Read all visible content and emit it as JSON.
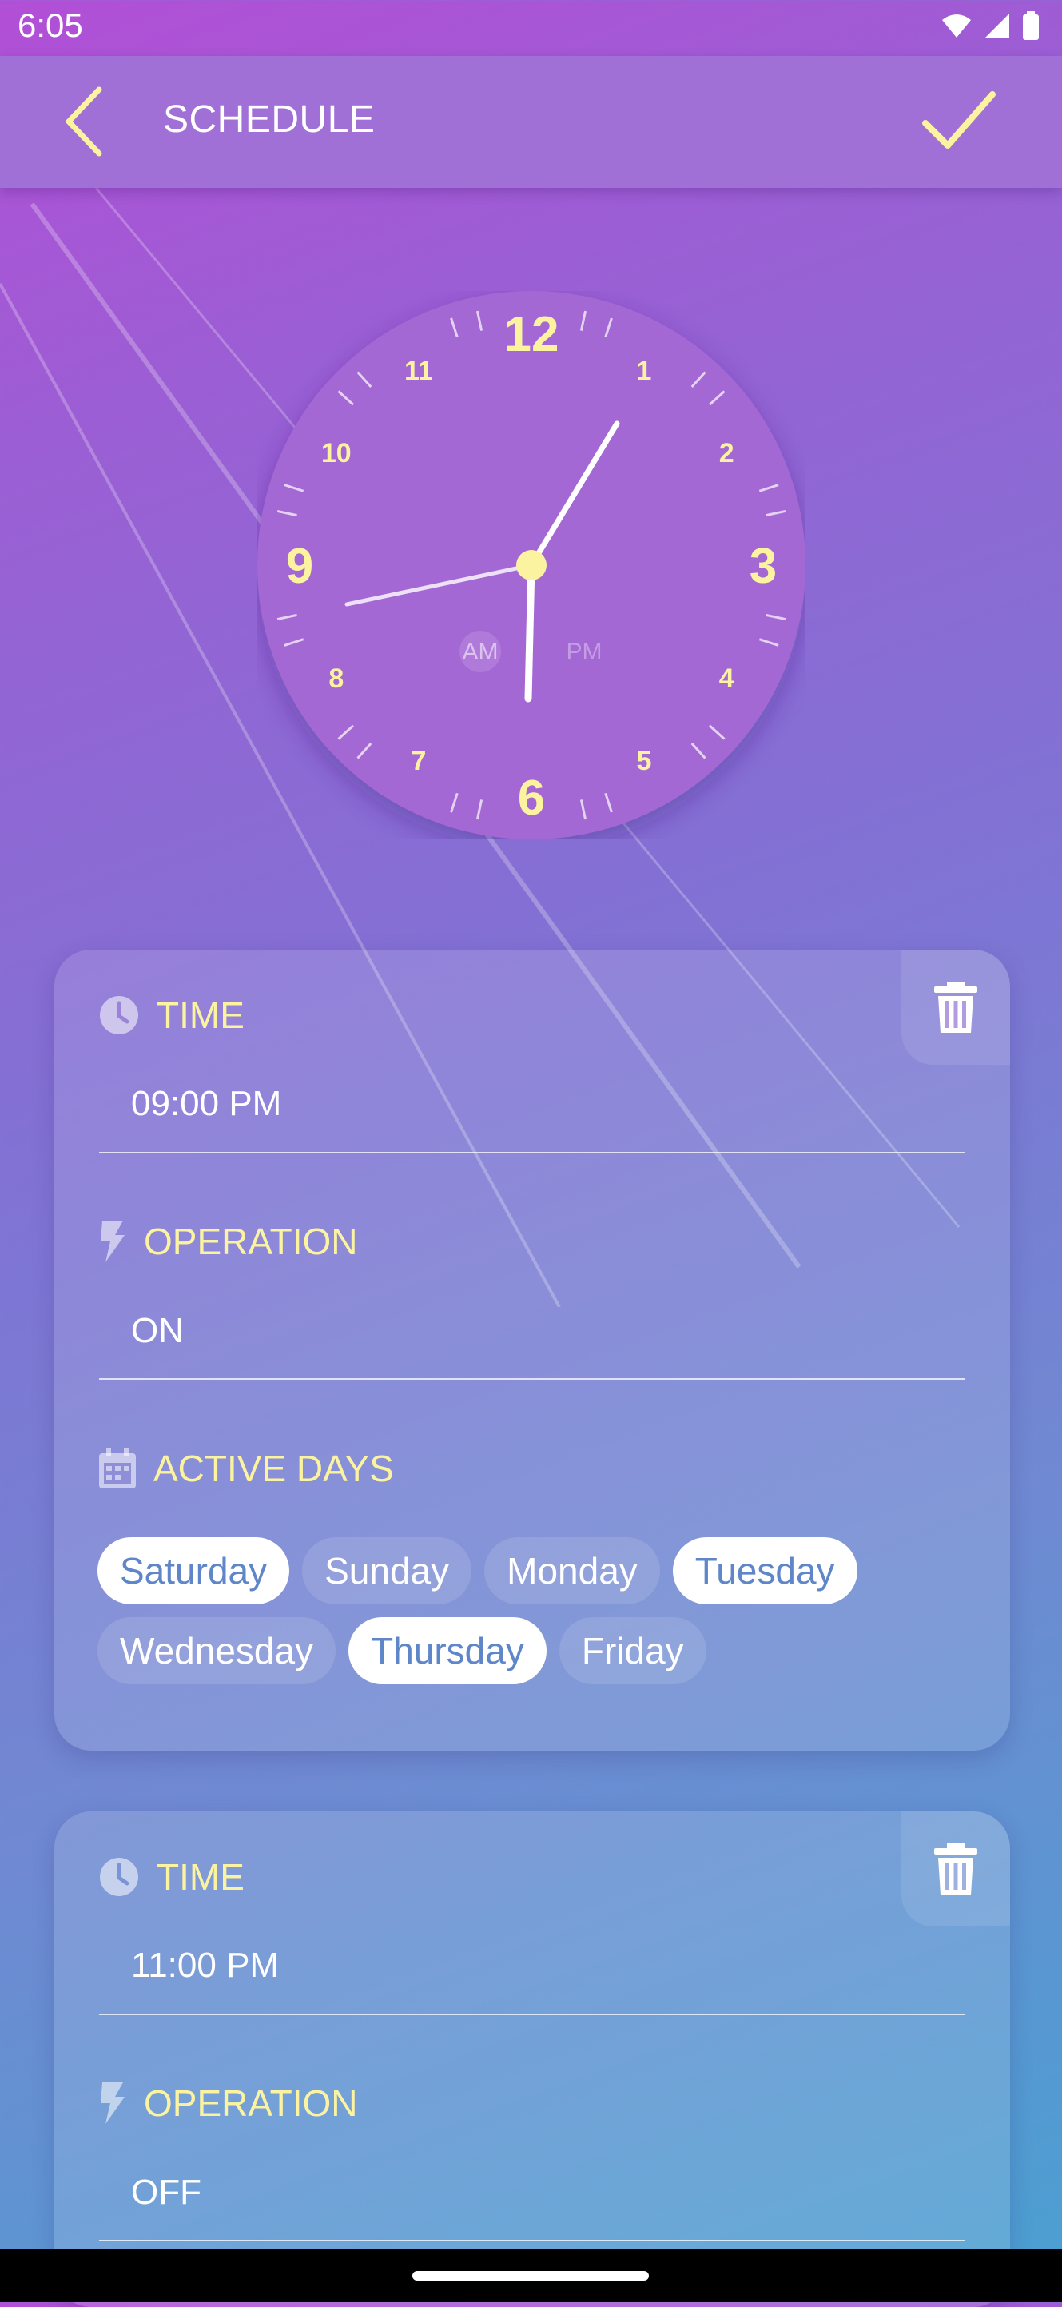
{
  "status": {
    "time": "6:05"
  },
  "appbar": {
    "title": "SCHEDULE"
  },
  "clock": {
    "numbers": [
      "12",
      "1",
      "2",
      "3",
      "4",
      "5",
      "6",
      "7",
      "8",
      "9",
      "10",
      "11"
    ],
    "am_label": "AM",
    "pm_label": "PM"
  },
  "schedules": [
    {
      "time_label": "TIME",
      "time_value": "09:00 PM",
      "operation_label": "OPERATION",
      "operation_value": "ON",
      "days_label": "ACTIVE DAYS",
      "days": [
        {
          "label": "Saturday",
          "active": true
        },
        {
          "label": "Sunday",
          "active": false
        },
        {
          "label": "Monday",
          "active": false
        },
        {
          "label": "Tuesday",
          "active": true
        },
        {
          "label": "Wednesday",
          "active": false
        },
        {
          "label": "Thursday",
          "active": true
        },
        {
          "label": "Friday",
          "active": false
        }
      ]
    },
    {
      "time_label": "TIME",
      "time_value": "11:00 PM",
      "operation_label": "OPERATION",
      "operation_value": "OFF"
    }
  ],
  "colors": {
    "accent": "#fbf3a0",
    "chip_active_text": "#5f86c8",
    "appbar": "#a070d6"
  },
  "icons": {
    "back": "chevron-left-icon",
    "confirm": "check-icon",
    "delete": "trash-icon",
    "time": "clock-icon",
    "operation": "bolt-icon",
    "days": "calendar-icon"
  }
}
